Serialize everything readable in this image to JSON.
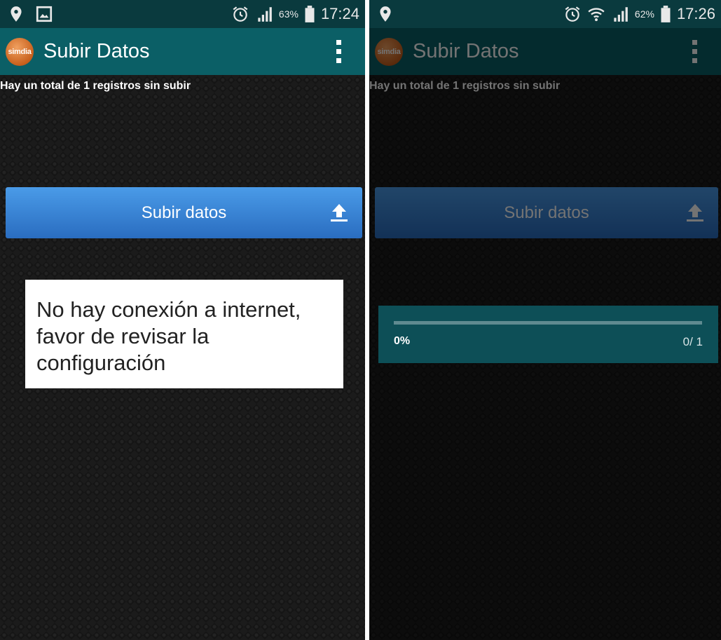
{
  "left": {
    "status": {
      "battery_pct": "63%",
      "time": "17:24"
    },
    "app": {
      "logo_text": "simdia",
      "title": "Subir Datos"
    },
    "records_text": "Hay un total de 1 registros sin subir",
    "upload_button_label": "Subir datos",
    "toast_message": "No hay conexión a internet, favor de revisar la configuración"
  },
  "right": {
    "status": {
      "battery_pct": "62%",
      "time": "17:26"
    },
    "app": {
      "logo_text": "simdia",
      "title": "Subir Datos"
    },
    "records_text": "Hay un total de 1 registros sin subir",
    "upload_button_label": "Subir datos",
    "progress": {
      "percent_label": "0%",
      "count_label": "0/ 1",
      "fraction": 0
    }
  },
  "colors": {
    "statusbar_bg": "#0a3a3e",
    "actionbar_bg": "#0b5f66",
    "button_blue": "#3a86d8",
    "dialog_bg": "#0d4f57",
    "logo_orange": "#c8601c"
  }
}
